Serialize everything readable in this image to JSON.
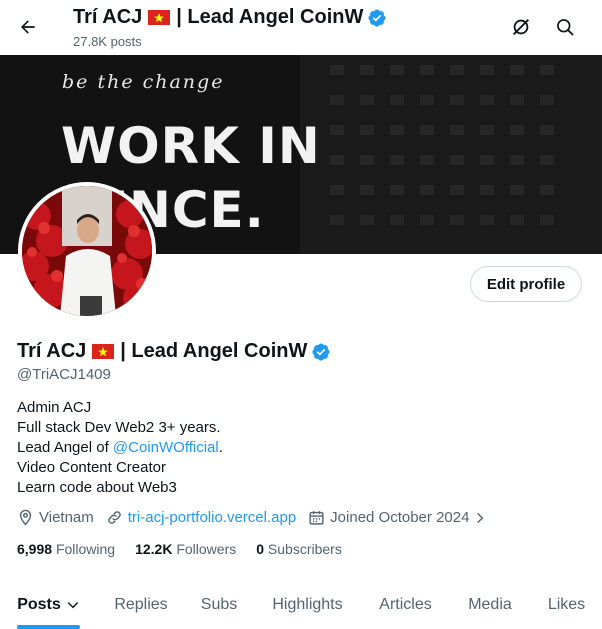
{
  "header": {
    "name_part1": "Trí ACJ",
    "name_part2": "| Lead Angel CoinW",
    "posts_count": "27.8K posts",
    "icons": [
      "back-arrow-icon",
      "grok-icon",
      "search-icon"
    ]
  },
  "banner": {
    "tagline": "be the change",
    "headline_line1": "WORK IN",
    "headline_line2": "LENCE."
  },
  "profile": {
    "name_part1": "Trí ACJ",
    "name_part2": "| Lead Angel CoinW",
    "handle": "@TriACJ1409",
    "edit_label": "Edit profile",
    "bio": {
      "line1": "Admin ACJ",
      "line2": "Full stack Dev Web2 3+ years.",
      "line3_prefix": "Lead Angel of ",
      "line3_link": "@CoinWOfficial",
      "line3_suffix": ".",
      "line4": "Video Content Creator",
      "line5": "Learn code about Web3"
    },
    "location": "Vietnam",
    "website": "tri-acj-portfolio.vercel.app",
    "joined": "Joined October 2024",
    "stats": {
      "following_count": "6,998",
      "following_label": "Following",
      "followers_count": "12.2K",
      "followers_label": "Followers",
      "subscribers_count": "0",
      "subscribers_label": "Subscribers"
    }
  },
  "tabs": [
    {
      "label": "Posts"
    },
    {
      "label": "Replies"
    },
    {
      "label": "Subs"
    },
    {
      "label": "Highlights"
    },
    {
      "label": "Articles"
    },
    {
      "label": "Media"
    },
    {
      "label": "Likes"
    }
  ],
  "colors": {
    "accent": "#1d9bf0",
    "text": "#0f1419",
    "muted": "#536471",
    "border": "#cfd9de",
    "flag_red": "#da251d",
    "flag_star": "#ffff00"
  }
}
